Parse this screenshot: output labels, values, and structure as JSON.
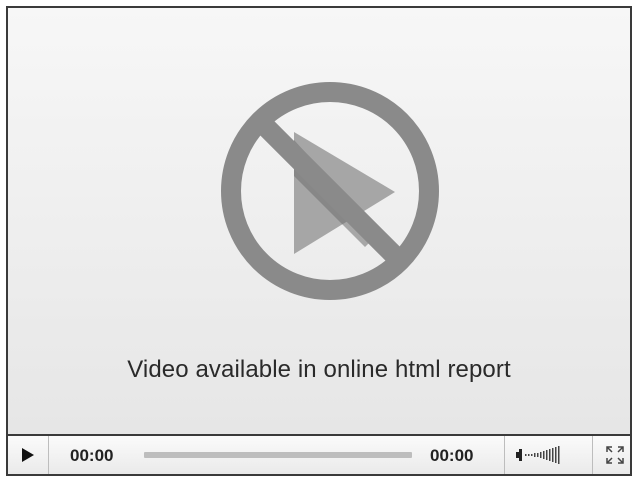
{
  "player": {
    "message": "Video available in online html report",
    "current_time": "00:00",
    "total_time": "00:00",
    "playback_progress": 0,
    "volume_level": 1,
    "icons": {
      "center": "no-video-icon",
      "play": "play-icon",
      "volume": "volume-icon",
      "fullscreen": "fullscreen-icon"
    },
    "colors": {
      "icon_gray": "#8a8a8a",
      "icon_dark": "#5e5e5e",
      "frame": "#3a3a3a"
    }
  }
}
